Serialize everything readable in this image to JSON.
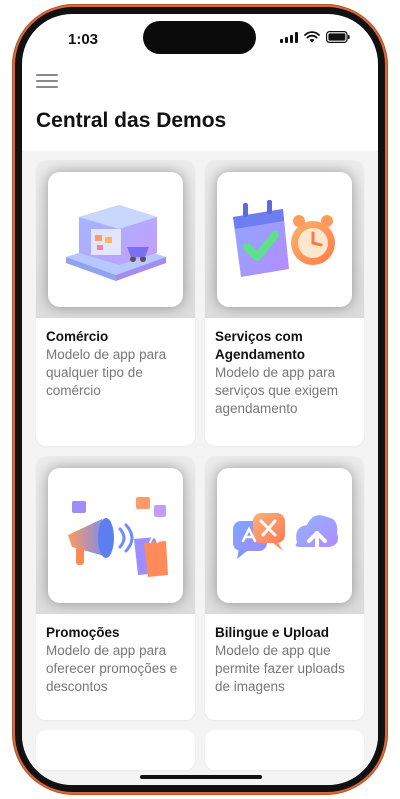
{
  "status_bar": {
    "time": "1:03",
    "icons": [
      "signal-icon",
      "wifi-icon",
      "battery-icon"
    ]
  },
  "header": {
    "menu_icon": "hamburger-menu-icon",
    "title": "Central das Demos"
  },
  "colors": {
    "phone_frame": "#d9683a",
    "content_bg": "#f4f4f4",
    "desc_text": "#777777"
  },
  "cards": [
    {
      "title": "Comércio",
      "description": "Modelo de app para qualquer tipo de comércio",
      "icon": "storefront-icon"
    },
    {
      "title": "Serviços com Agendamento",
      "description": "Modelo de app para serviços que exigem agendamento",
      "icon": "calendar-clock-icon"
    },
    {
      "title": "Promoções",
      "description": "Modelo de app para oferecer promoções e descontos",
      "icon": "megaphone-shopping-icon"
    },
    {
      "title": "Bilingue e Upload",
      "description": "Modelo de app que permite fazer uploads de imagens",
      "icon": "translate-upload-icon"
    }
  ]
}
